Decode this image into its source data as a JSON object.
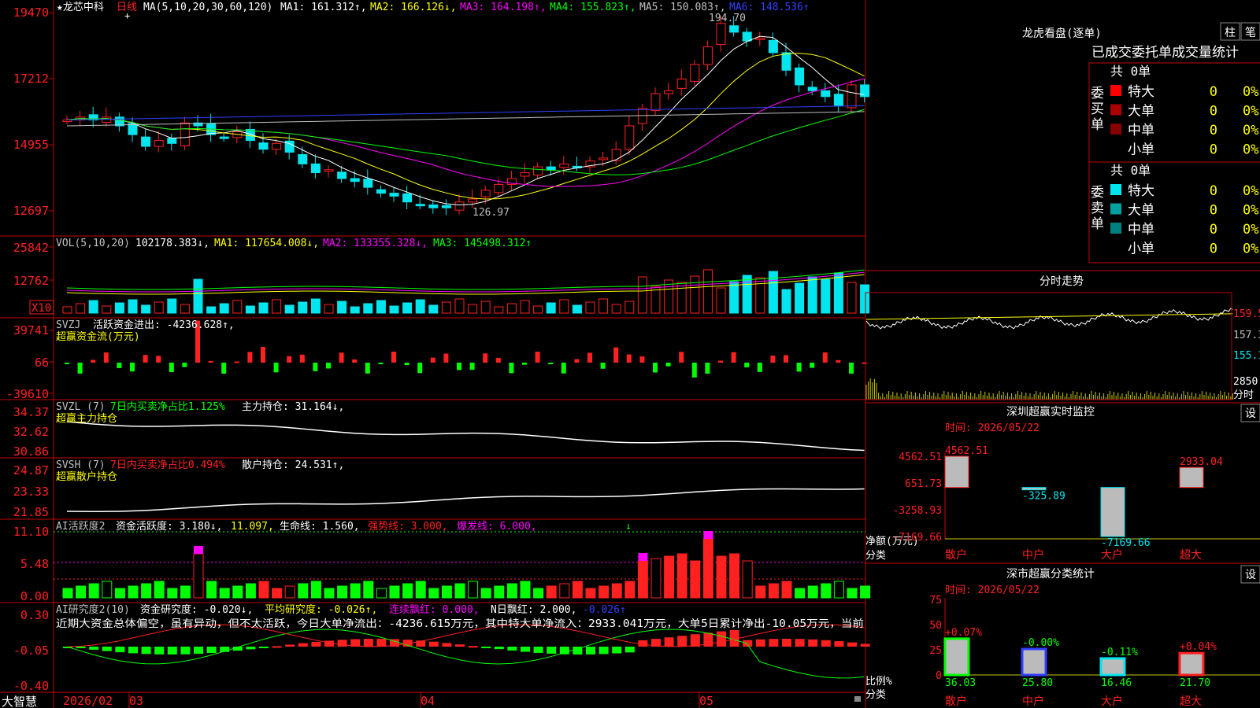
{
  "colors": {
    "up": "#ff2020",
    "down": "#00e5ee",
    "grid": "#c00000",
    "white": "#ffffff",
    "yellow": "#ffff00",
    "magenta": "#ff00ff",
    "green": "#00ff00",
    "blue": "#3040ff",
    "gray": "#c0c0c0"
  },
  "price_panel": {
    "stock_name": "★龙芯中科",
    "period": "日线",
    "ma_title": "MA(5,10,20,30,60,120)",
    "ma1": "MA1: 161.312↑,",
    "ma2": "MA2: 166.126↓,",
    "ma3": "MA3: 164.198↑,",
    "ma4": "MA4: 155.823↑,",
    "ma5": "MA5: 150.083↑,",
    "ma6": "MA6: 148.536↑",
    "axis": [
      "19470",
      "17212",
      "14955",
      "12697"
    ],
    "high_label": "194.70",
    "low_label": "126.97"
  },
  "vol_panel": {
    "title": "VOL(5,10,20)",
    "value": "102178.383↓,",
    "ma1": "MA1: 117654.008↓,",
    "ma2": "MA2: 133355.328↓,",
    "ma3": "MA3: 145498.312↑",
    "axis": [
      "25842",
      "12762"
    ],
    "unit": "X10"
  },
  "svzj_panel": {
    "title": "SVZJ",
    "desc": "活跃资金进出: -4236.628↑,",
    "sub": "超赢资金流(万元)",
    "axis": [
      "39741",
      "66",
      "-39610"
    ]
  },
  "svzl_panel": {
    "title": "SVZL (7)",
    "desc": "7日内买卖净占比1.125%",
    "main": "主力持仓: 31.164↓,",
    "sub": "超赢主力持仓",
    "axis": [
      "34.37",
      "32.62",
      "30.86"
    ]
  },
  "svsh_panel": {
    "title": "SVSH (7)",
    "desc": "7日内买卖净占比0.494%",
    "main": "散户持仓: 24.531↑,",
    "sub": "超赢散户持仓",
    "axis": [
      "24.87",
      "23.33",
      "21.85"
    ]
  },
  "ai_active_panel": {
    "title": "AI活跃度2",
    "a": "资金活跃度: 3.180↓,",
    "b": "11.097,",
    "c": "生命线: 1.560,",
    "d": "强势线: 3.000,",
    "e": "爆发线: 6.000,",
    "axis": [
      "11.10",
      "5.48",
      "0.00"
    ]
  },
  "ai_research_panel": {
    "title": "AI研究度2(10)",
    "a": "资金研究度: -0.020↓,",
    "b": "平均研究度: -0.026↑,",
    "c": "连续飘红: 0.000,",
    "d": "N日飘红: 2.000,",
    "e": "-0.026↑",
    "summary": "近期大资金总体偏空，虽有异动，但不太活跃，今日大单净流出：-4236.615万元，其中特大单净流入：2933.041万元，大单5日累计净出-10.05万元，当前",
    "axis": [
      "0.30",
      "-0.05",
      "-0.40"
    ]
  },
  "date_axis": {
    "brand": "大智慧",
    "labels": [
      "2026/02",
      "03",
      "04",
      "05"
    ]
  },
  "dragon_tiger": {
    "title": "龙虎看盘(逐单)",
    "btn_col": "柱",
    "btn_bi": "笔",
    "header": "已成交委托单成交量统计",
    "buy": {
      "side": "委买单",
      "total": "共 0单",
      "rows": [
        {
          "label": "特大",
          "count": "0",
          "pct": "0%"
        },
        {
          "label": "大单",
          "count": "0",
          "pct": "0%"
        },
        {
          "label": "中单",
          "count": "0",
          "pct": "0%"
        },
        {
          "label": "小单",
          "count": "0",
          "pct": "0%"
        }
      ]
    },
    "sell": {
      "side": "委卖单",
      "total": "共 0单",
      "rows": [
        {
          "label": "特大",
          "count": "0",
          "pct": "0%"
        },
        {
          "label": "大单",
          "count": "0",
          "pct": "0%"
        },
        {
          "label": "中单",
          "count": "0",
          "pct": "0%"
        },
        {
          "label": "小单",
          "count": "0",
          "pct": "0%"
        }
      ]
    }
  },
  "intraday": {
    "title": "分时走势",
    "axis": [
      "159.5",
      "157.3",
      "155.1",
      "2850",
      "分时"
    ]
  },
  "sz_monitor": {
    "title": "深圳超赢实时监控",
    "btn": "设",
    "time": "时间: 2026/05/22",
    "axis": [
      "4562.51",
      "651.73",
      "-3258.93",
      "-7169.66"
    ],
    "ylabel1": "净额(万元)",
    "ylabel2": "分类",
    "categories": [
      "散户",
      "中户",
      "大户",
      "超大"
    ],
    "values": [
      4562.51,
      -325.89,
      -7169.66,
      2933.04
    ],
    "value_labels": [
      "4562.51",
      "-325.89",
      "-7169.66",
      "2933.04"
    ]
  },
  "sz_class": {
    "title": "深市超赢分类统计",
    "btn": "设",
    "time": "时间: 2026/05/22",
    "axis": [
      "75",
      "50",
      "25",
      "0"
    ],
    "ylabel1": "比例%",
    "ylabel2": "分类",
    "categories": [
      "散户",
      "中户",
      "大户",
      "超大"
    ],
    "values": [
      36.03,
      25.8,
      16.46,
      21.7
    ],
    "value_labels": [
      "36.03",
      "25.80",
      "16.46",
      "21.70"
    ],
    "change_labels": [
      "+0.07%",
      "-0.00%",
      "-0.11%",
      "+0.04%"
    ]
  }
}
